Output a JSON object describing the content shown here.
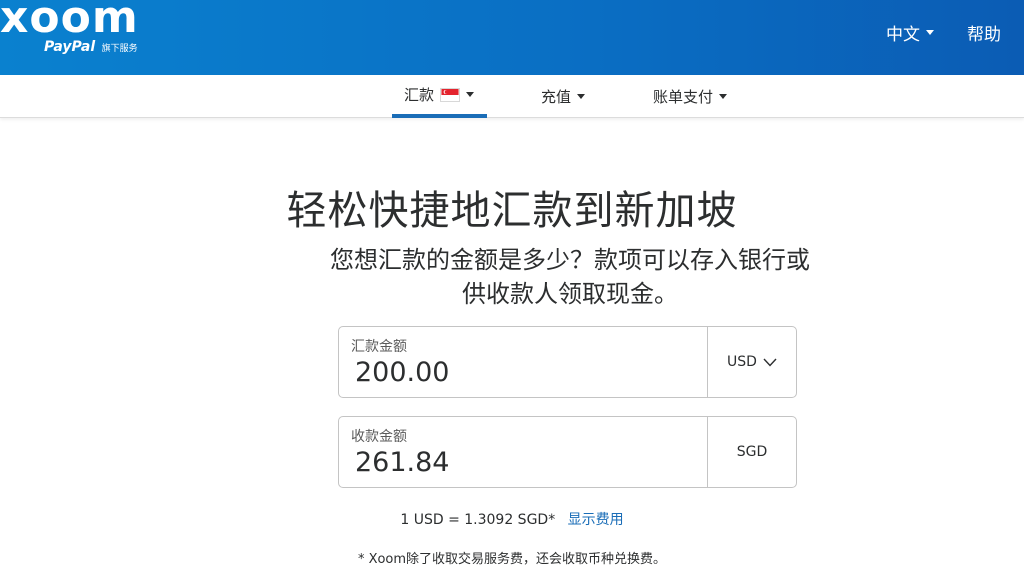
{
  "header": {
    "logo": {
      "brand": "xoom",
      "sub_brand": "PayPal",
      "tagline": "旗下服务"
    },
    "language": "中文",
    "help": "帮助",
    "colors": {
      "gradient_start": "#0a81cf",
      "gradient_end": "#0b5cb4"
    }
  },
  "nav": {
    "items": [
      {
        "label": "汇款",
        "flag": "singapore-flag-icon",
        "active": true
      },
      {
        "label": "充值",
        "active": false
      },
      {
        "label": "账单支付",
        "active": false
      }
    ],
    "accent": "#1a6db7"
  },
  "main": {
    "title": "轻松快捷地汇款到新加坡",
    "subtitle": "您想汇款的金额是多少？款项可以存入银行或供收款人领取现金。",
    "send": {
      "label": "汇款金额",
      "value": "200.00",
      "currency": "USD"
    },
    "receive": {
      "label": "收款金额",
      "value": "261.84",
      "currency": "SGD"
    },
    "rate": "1 USD = 1.3092 SGD*",
    "fee_link": "显示费用",
    "footnote": "* Xoom除了收取交易服务费，还会收取币种兑换费。"
  }
}
